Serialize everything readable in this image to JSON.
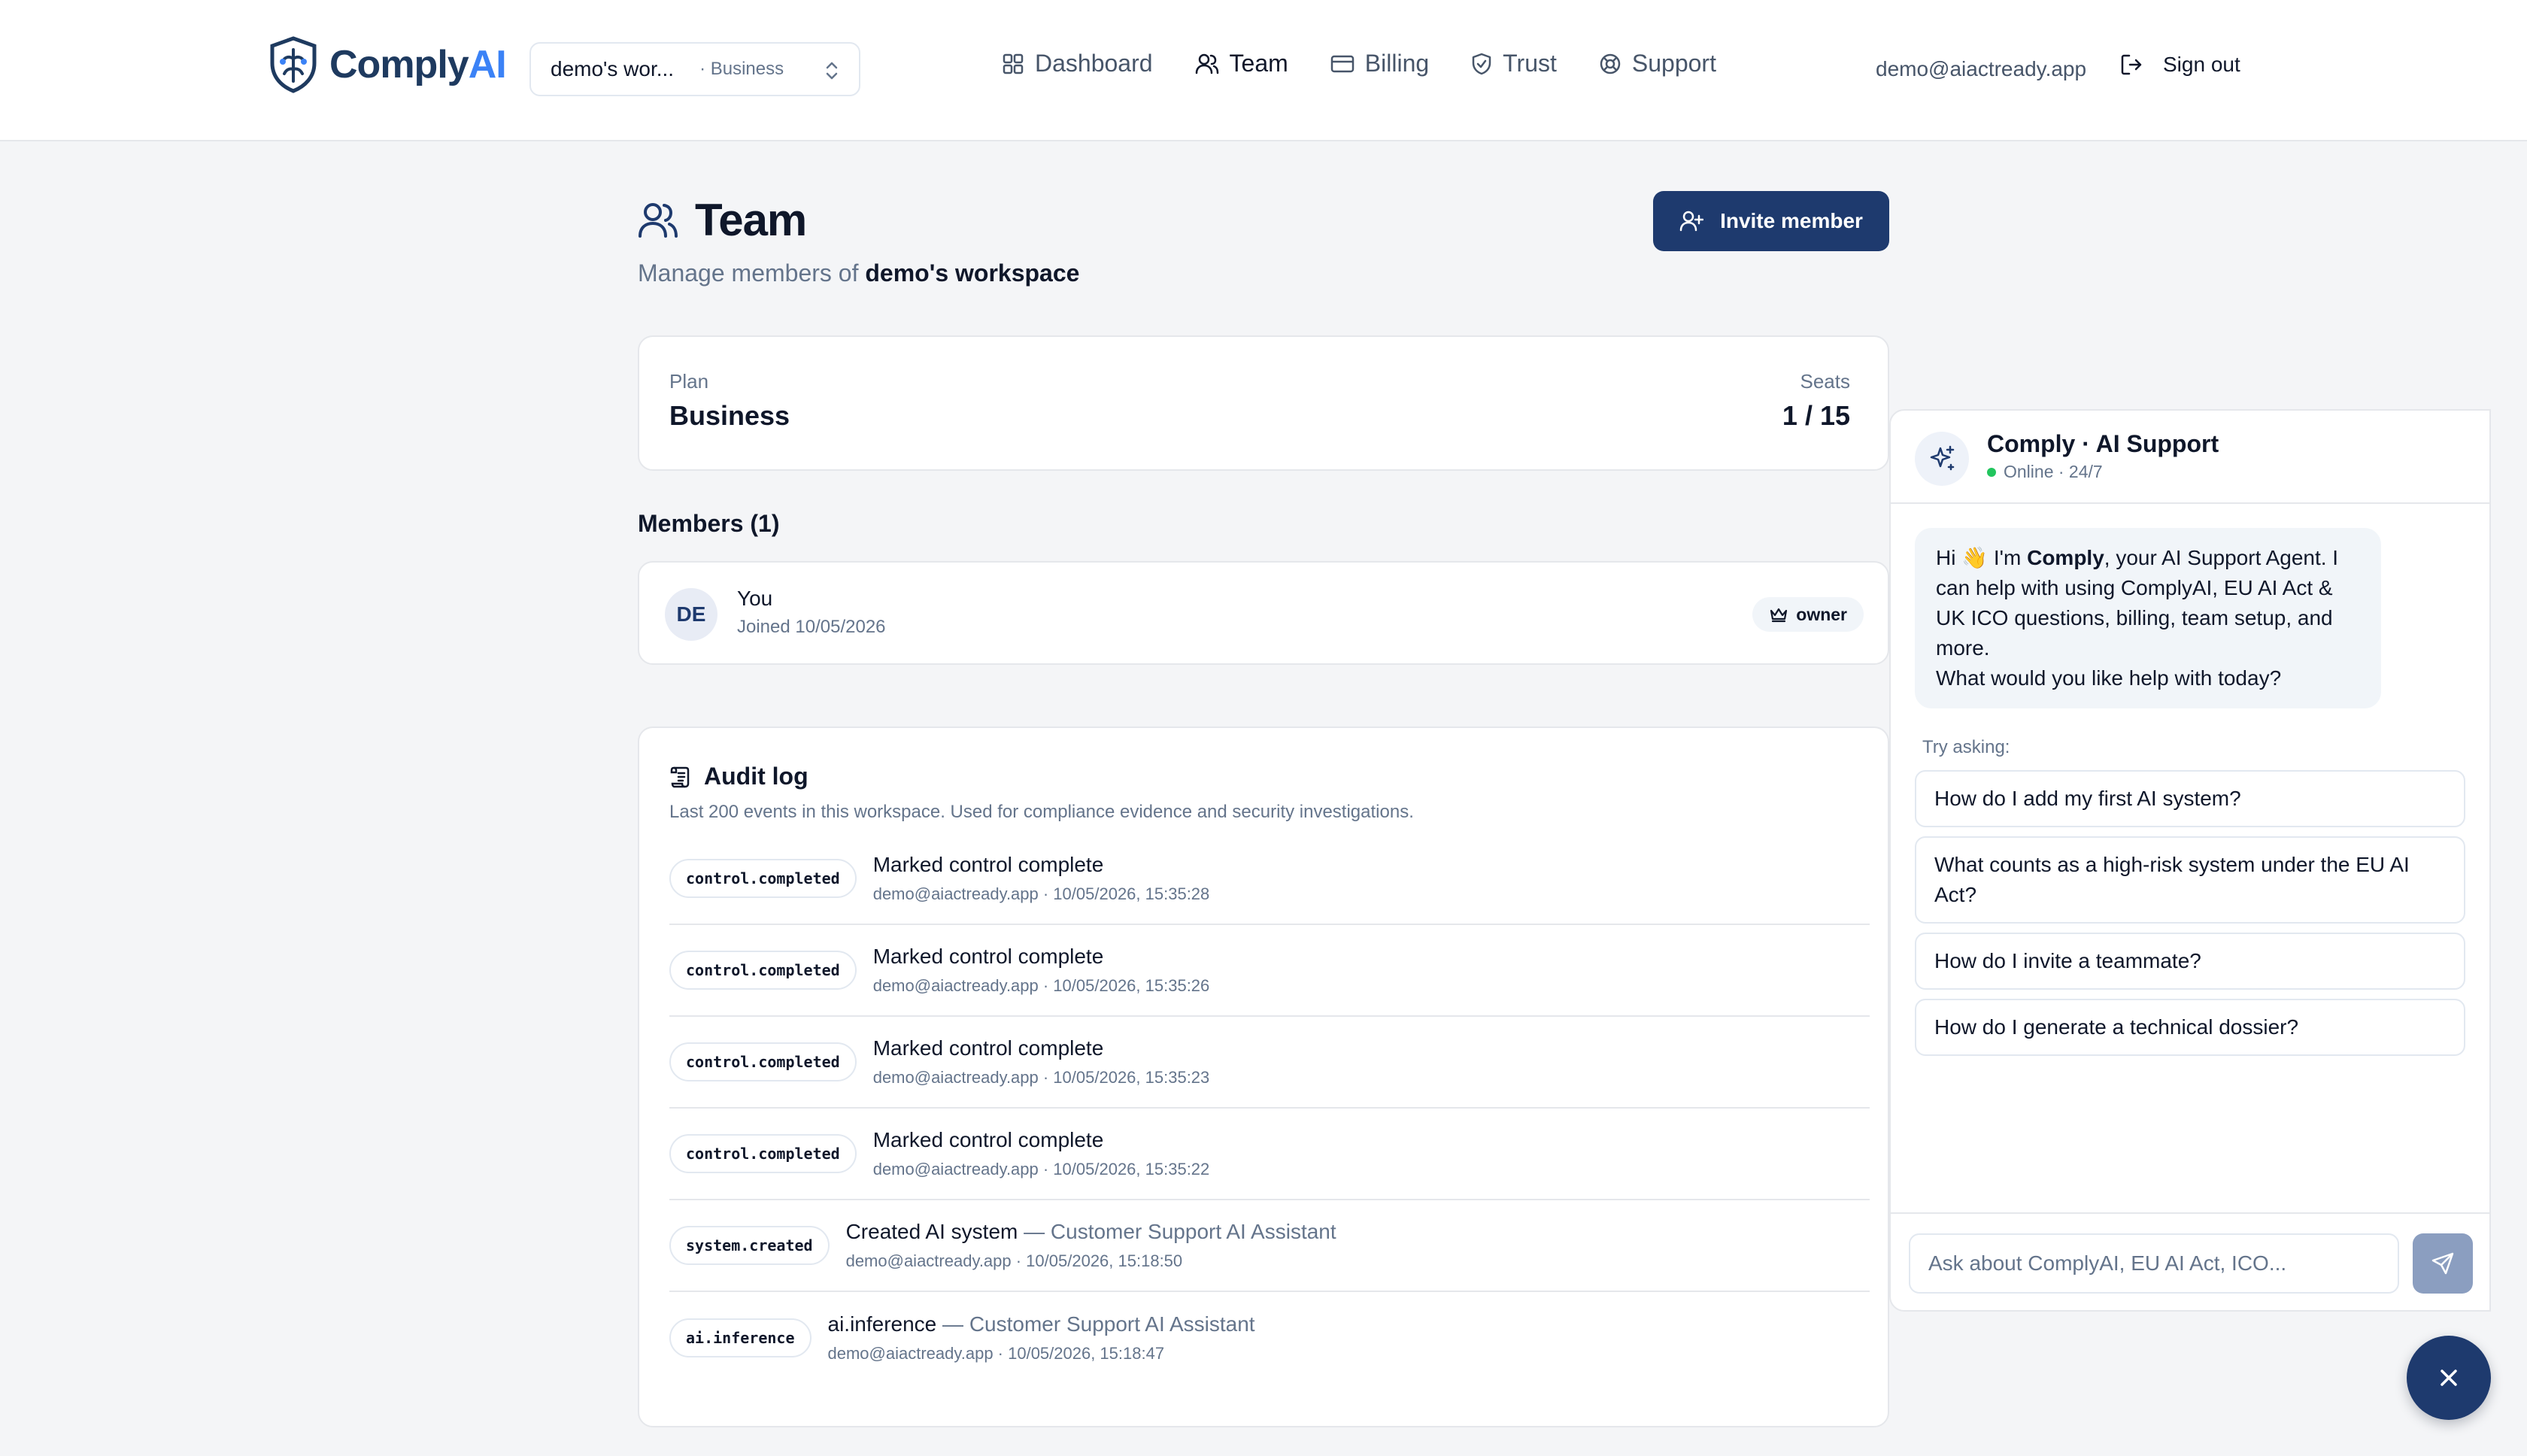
{
  "brand": {
    "name_prefix": "Comply",
    "name_suffix": "AI",
    "logo_icon": "shield-logo-icon"
  },
  "workspace_switcher": {
    "name": "demo's wor...",
    "plan": "· Business",
    "icon": "chevron-up-down-icon"
  },
  "nav": {
    "items": [
      {
        "label": "Dashboard",
        "icon": "grid-icon"
      },
      {
        "label": "Team",
        "icon": "users-icon",
        "active": true
      },
      {
        "label": "Billing",
        "icon": "credit-card-icon"
      },
      {
        "label": "Trust",
        "icon": "shield-check-icon"
      },
      {
        "label": "Support",
        "icon": "life-buoy-icon"
      }
    ]
  },
  "user": {
    "email": "demo@aiactready.app",
    "signout_label": "Sign out"
  },
  "page": {
    "title": "Team",
    "subtitle_prefix": "Manage members of",
    "subtitle_workspace": "demo's workspace",
    "invite_label": "Invite member"
  },
  "plan_card": {
    "plan_label": "Plan",
    "plan_value": "Business",
    "seats_label": "Seats",
    "seats_value": "1 / 15"
  },
  "members": {
    "title": "Members (1)",
    "items": [
      {
        "initials": "DE",
        "name": "You",
        "joined": "Joined 10/05/2026",
        "role": "owner"
      }
    ]
  },
  "audit": {
    "title": "Audit log",
    "description": "Last 200 events in this workspace. Used for compliance evidence and security investigations.",
    "events": [
      {
        "type": "control.completed",
        "action": "Marked control complete",
        "target": "",
        "meta": "demo@aiactready.app · 10/05/2026, 15:35:28"
      },
      {
        "type": "control.completed",
        "action": "Marked control complete",
        "target": "",
        "meta": "demo@aiactready.app · 10/05/2026, 15:35:26"
      },
      {
        "type": "control.completed",
        "action": "Marked control complete",
        "target": "",
        "meta": "demo@aiactready.app · 10/05/2026, 15:35:23"
      },
      {
        "type": "control.completed",
        "action": "Marked control complete",
        "target": "",
        "meta": "demo@aiactready.app · 10/05/2026, 15:35:22"
      },
      {
        "type": "system.created",
        "action": "Created AI system",
        "target": "— Customer Support AI Assistant",
        "meta": "demo@aiactready.app · 10/05/2026, 15:18:50"
      },
      {
        "type": "ai.inference",
        "action": "ai.inference",
        "target": "— Customer Support AI Assistant",
        "meta": "demo@aiactready.app · 10/05/2026, 15:18:47"
      }
    ]
  },
  "chat": {
    "title": "Comply · AI Support",
    "status": "Online · 24/7",
    "status_color": "#22c55e",
    "greeting_hi": "Hi 👋 I'm",
    "greeting_name": "Comply",
    "greeting_rest": ", your AI Support Agent. I can help with using ComplyAI, EU AI Act & UK ICO questions, billing, team setup, and more.",
    "greeting_question": "What would you like help with today?",
    "try_label": "Try asking:",
    "suggestions": [
      "How do I add my first AI system?",
      "What counts as a high-risk system under the EU AI Act?",
      "How do I invite a teammate?",
      "How do I generate a technical dossier?"
    ],
    "input_placeholder": "Ask about ComplyAI, EU AI Act, ICO...",
    "input_value": ""
  },
  "colors": {
    "primary": "#1e3a6e",
    "accent": "#3b82f6",
    "send_disabled": "#8b9ec0"
  }
}
